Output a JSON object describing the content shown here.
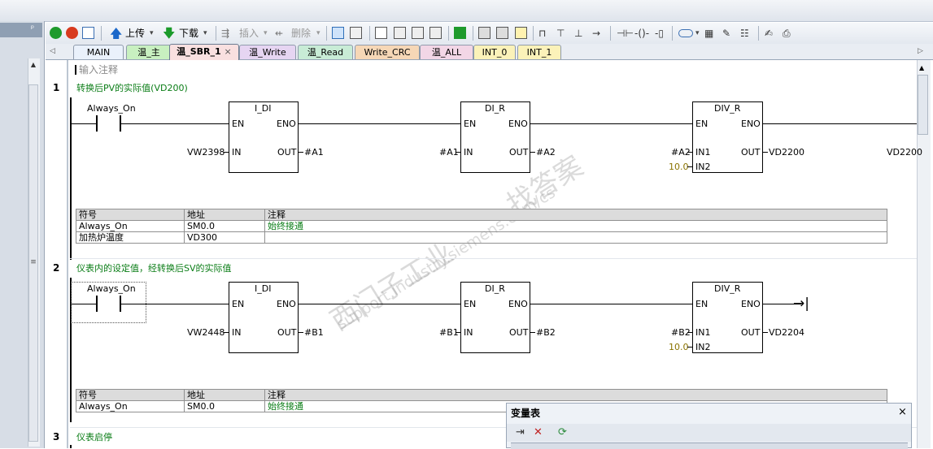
{
  "toolbar": {
    "upload_label": "上传",
    "download_label": "下载",
    "insert_label": "插入",
    "delete_label": "删除"
  },
  "tabs": [
    {
      "label": "MAIN",
      "color": "#eaf1fb"
    },
    {
      "label": "温_主",
      "color": "#c8f0c0"
    },
    {
      "label": "温_SBR_1",
      "color": "#f9e0e0",
      "active": true
    },
    {
      "label": "温_Write",
      "color": "#e6d5f2"
    },
    {
      "label": "温_Read",
      "color": "#c8ecd6"
    },
    {
      "label": "Write_CRC",
      "color": "#f6d7b6"
    },
    {
      "label": "温_ALL",
      "color": "#f2d6e6"
    },
    {
      "label": "INT_0",
      "color": "#fbf2b9"
    },
    {
      "label": "INT_1",
      "color": "#fbf2b9"
    }
  ],
  "tab_close": "×",
  "comment_placeholder": "输入注释",
  "networks": [
    {
      "number": "1",
      "title": "转换后PV的实际值(VD200)",
      "contact": "Always_On",
      "blocks": [
        {
          "name": "I_DI",
          "en": "EN",
          "eno": "ENO",
          "in": "IN",
          "out": "OUT",
          "in_val": "VW2398",
          "out_val": "#A1"
        },
        {
          "name": "DI_R",
          "en": "EN",
          "eno": "ENO",
          "in": "IN",
          "out": "OUT",
          "in_val": "#A1",
          "out_val": "#A2"
        },
        {
          "name": "DIV_R",
          "en": "EN",
          "eno": "ENO",
          "in1": "IN1",
          "in2": "IN2",
          "out": "OUT",
          "in1_val": "#A2",
          "in2_val": "10.0",
          "out_val": "VD2200"
        }
      ],
      "extra_out": "VD2200",
      "symbols": {
        "headers": [
          "符号",
          "地址",
          "注释"
        ],
        "rows": [
          [
            "Always_On",
            "SM0.0",
            "始终接通"
          ],
          [
            "加热炉温度",
            "VD300",
            ""
          ]
        ]
      }
    },
    {
      "number": "2",
      "title": "仪表内的设定值，经转换后SV的实际值",
      "contact": "Always_On",
      "blocks": [
        {
          "name": "I_DI",
          "en": "EN",
          "eno": "ENO",
          "in": "IN",
          "out": "OUT",
          "in_val": "VW2448",
          "out_val": "#B1"
        },
        {
          "name": "DI_R",
          "en": "EN",
          "eno": "ENO",
          "in": "IN",
          "out": "OUT",
          "in_val": "#B1",
          "out_val": "#B2"
        },
        {
          "name": "DIV_R",
          "en": "EN",
          "eno": "ENO",
          "in1": "IN1",
          "in2": "IN2",
          "out": "OUT",
          "in1_val": "#B2",
          "in2_val": "10.0",
          "out_val": "VD2204"
        }
      ],
      "symbols": {
        "headers": [
          "符号",
          "地址",
          "注释"
        ],
        "rows": [
          [
            "Always_On",
            "SM0.0",
            "始终接通"
          ]
        ]
      }
    },
    {
      "number": "3",
      "title": "仪表启停"
    }
  ],
  "watermark": {
    "line1": "西门子工业",
    "line2": "找答案",
    "line3": "support.industry.siemens.com/cs"
  },
  "var_table": {
    "title": "变量表",
    "close": "×"
  },
  "colors": {
    "comment_green": "#0a7d16",
    "constant_olive": "#8a7300"
  }
}
